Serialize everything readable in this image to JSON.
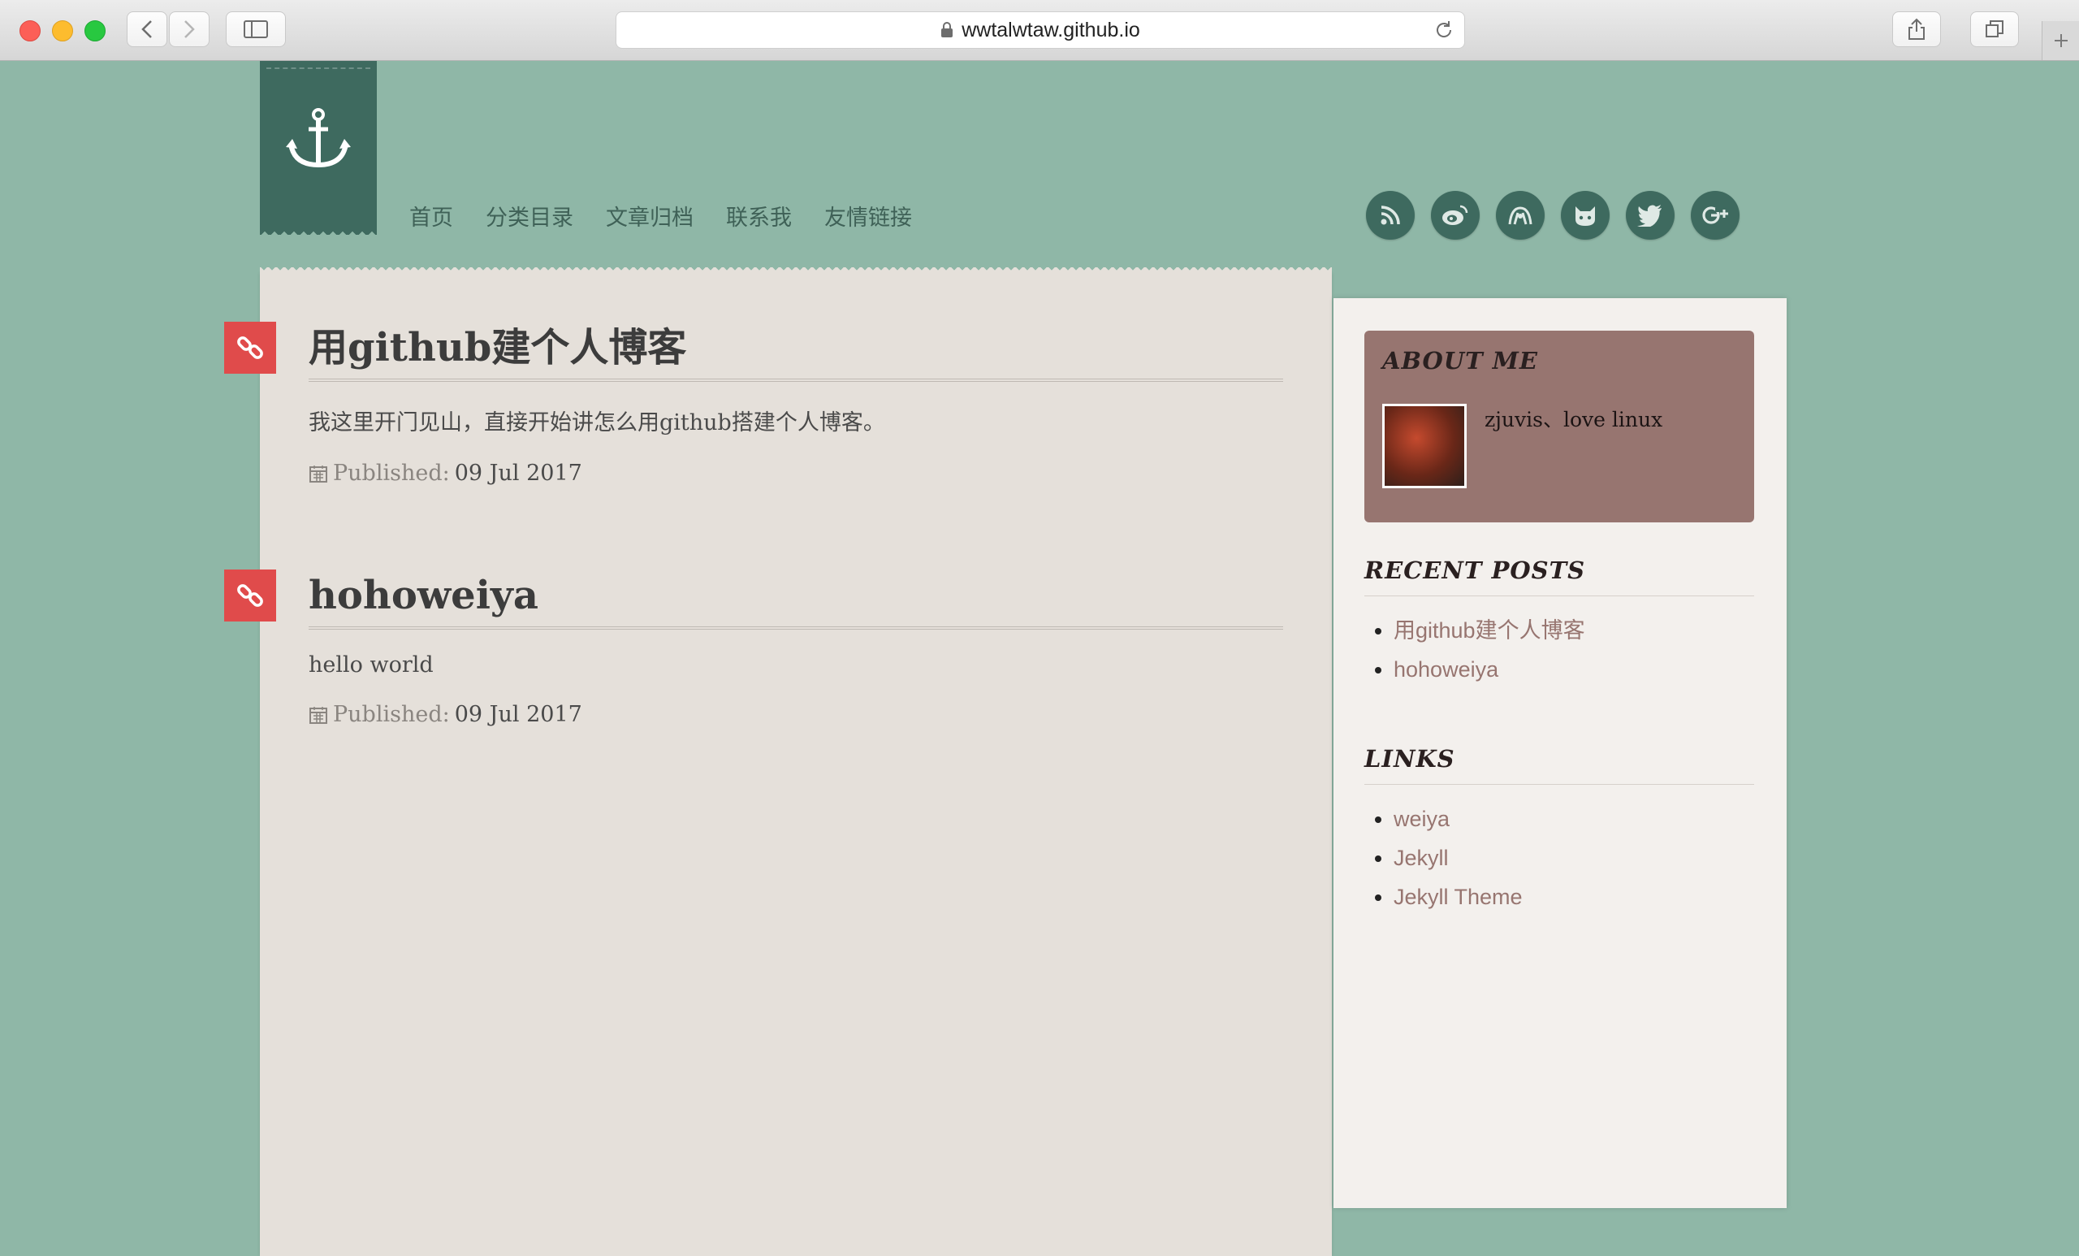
{
  "browser": {
    "url": "wwtalwtaw.github.io"
  },
  "nav": {
    "items": [
      "首页",
      "分类目录",
      "文章归档",
      "联系我",
      "友情链接"
    ]
  },
  "social": [
    "rss-icon",
    "weibo-icon",
    "douban-icon",
    "github-icon",
    "twitter-icon",
    "google-plus-icon"
  ],
  "posts": [
    {
      "title": "用github建个人博客",
      "excerpt": "我这里开门见山，直接开始讲怎么用github搭建个人博客。",
      "published_label": "Published:",
      "date": "09 Jul 2017"
    },
    {
      "title": "hohoweiya",
      "excerpt": "hello world",
      "published_label": "Published:",
      "date": "09 Jul 2017"
    }
  ],
  "sidebar": {
    "about": {
      "title": "ABOUT ME",
      "bio": "zjuvis、love linux"
    },
    "recent": {
      "title": "RECENT POSTS",
      "items": [
        "用github建个人博客",
        "hohoweiya"
      ]
    },
    "links": {
      "title": "LINKS",
      "items": [
        "weiya",
        "Jekyll",
        "Jekyll Theme"
      ]
    }
  },
  "colors": {
    "background": "#8fb7a7",
    "accent_dark_green": "#3e6a5f",
    "post_icon_red": "#e04b4b",
    "about_box": "#977570"
  }
}
